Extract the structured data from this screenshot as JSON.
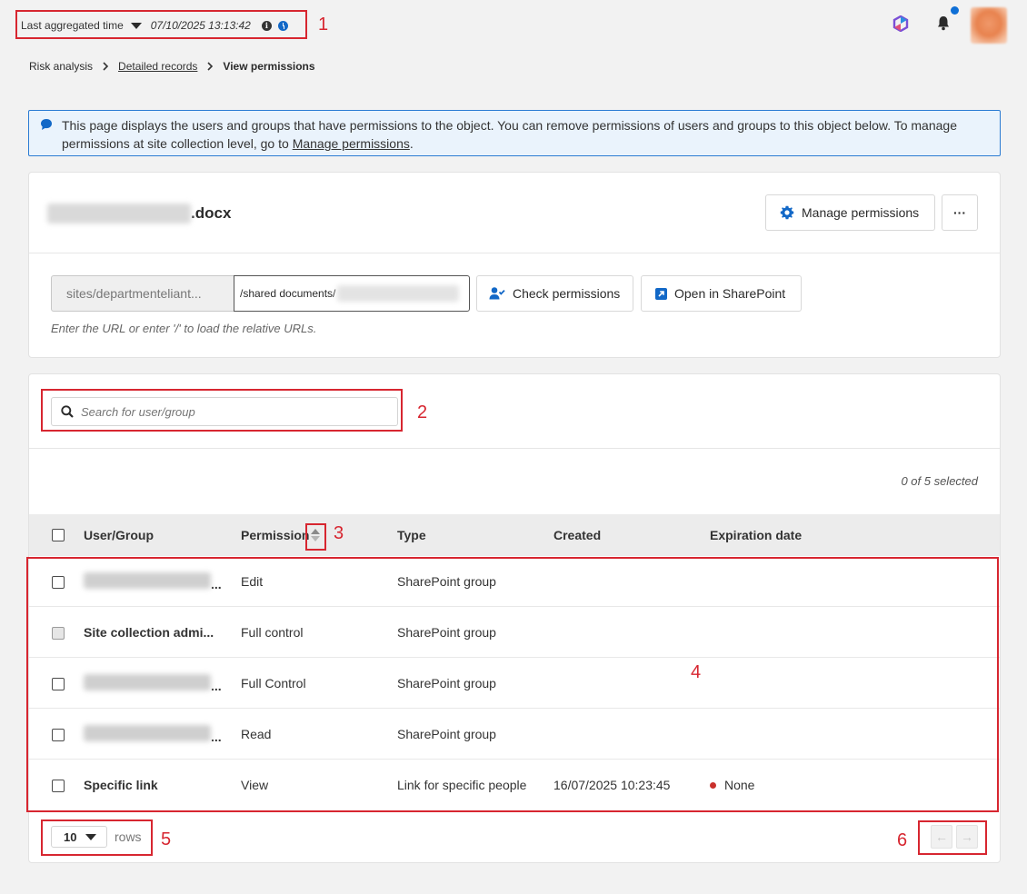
{
  "topbar": {
    "agg_label": "Last aggregated time",
    "agg_time": "07/10/2025 13:13:42",
    "info_glyph": "i"
  },
  "breadcrumb": {
    "items": [
      "Risk analysis",
      "Detailed records",
      "View permissions"
    ]
  },
  "banner": {
    "text_before": "This page displays the users and groups that have permissions to the object. You can remove permissions of users and groups to this object below. To manage permissions at site collection level, go to ",
    "link": "Manage permissions",
    "text_after": "."
  },
  "object": {
    "file_suffix": ".docx",
    "manage_label": "Manage permissions",
    "more_label": "···",
    "url_prefix": "sites/departmenteliant...",
    "url_path": "/shared documents/",
    "check_label": "Check permissions",
    "open_label": "Open in SharePoint",
    "hint": "Enter the URL or enter '/' to load the relative URLs."
  },
  "table": {
    "search_placeholder": "Search for user/group",
    "selected_count": "0 of 5 selected",
    "headers": [
      "User/Group",
      "Permission",
      "Type",
      "Created",
      "Expiration date"
    ],
    "rows": [
      {
        "user": "",
        "permission": "Edit",
        "type": "SharePoint group",
        "created": "",
        "expiration": ""
      },
      {
        "user": "Site collection admi...",
        "permission": "Full control",
        "type": "SharePoint group",
        "created": "",
        "expiration": ""
      },
      {
        "user": "",
        "permission": "Full Control",
        "type": "SharePoint group",
        "created": "",
        "expiration": ""
      },
      {
        "user": "",
        "permission": "Read",
        "type": "SharePoint group",
        "created": "",
        "expiration": ""
      },
      {
        "user": "Specific link",
        "permission": "View",
        "type": "Link for specific people",
        "created": "16/07/2025 10:23:45",
        "expiration": "None"
      }
    ],
    "rows_value": "10",
    "rows_label": "rows",
    "prev_label": "←",
    "next_label": "→"
  },
  "annotations": [
    "1",
    "2",
    "3",
    "4",
    "5",
    "6"
  ],
  "colors": {
    "annotation": "#d72630",
    "accent": "#1268c7",
    "expiration_dot": "#c9302c"
  }
}
